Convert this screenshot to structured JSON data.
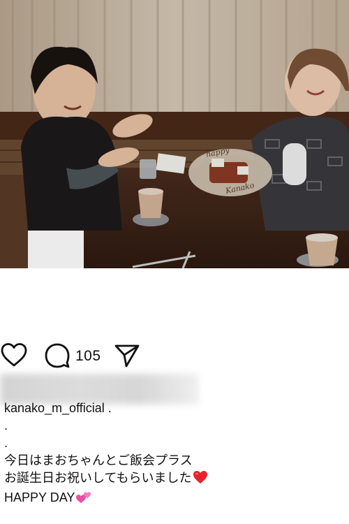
{
  "post": {
    "photo_alt": "photo",
    "comment_count": "105",
    "caption_lines": [
      "kanako_m_official .",
      ".",
      ".",
      "今日はまおちゃんとご飯会プラス",
      "お誕生日お祝いしてもらいました",
      "HAPPY DAY"
    ],
    "plate_text": [
      "happy",
      "Kanako"
    ]
  },
  "icons": {
    "like": "heart-outline-icon",
    "comment": "comment-bubble-icon",
    "share": "paper-plane-icon",
    "caption_emoji_1": "red-heart-emoji",
    "caption_emoji_2": "two-pink-hearts-emoji"
  },
  "colors": {
    "red_heart": "#e8232e",
    "pink_heart": "#e94fa4",
    "text": "#111111"
  }
}
